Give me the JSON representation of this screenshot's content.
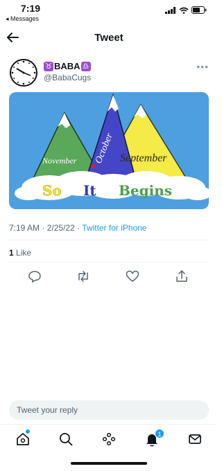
{
  "status_bar": {
    "time": "7:19",
    "back_label": "◂ Messages"
  },
  "nav": {
    "title": "Tweet"
  },
  "author": {
    "name": "BABA",
    "zodiac_left": "♉",
    "zodiac_right": "♎",
    "handle": "@BabaCugs",
    "more": "•••"
  },
  "tweet": {
    "image": {
      "labels": {
        "left": "November",
        "middle": "October",
        "right": "September"
      },
      "banner": [
        "So",
        "It",
        "Begins"
      ]
    },
    "time": "7:19 AM",
    "date": "2/25/22",
    "source": "Twitter for iPhone",
    "separator": "·"
  },
  "engagement": {
    "count": "1",
    "label": "Like"
  },
  "reply": {
    "placeholder": "Tweet your reply"
  },
  "tabs": [
    {
      "name": "home-icon"
    },
    {
      "name": "search-icon"
    },
    {
      "name": "spaces-icon"
    },
    {
      "name": "notifications-icon",
      "badge": "1"
    },
    {
      "name": "messages-icon"
    }
  ],
  "colors": {
    "accent": "#1d9bf0",
    "sky": "#4e9fe0",
    "green_peak": "#5aa85a",
    "blue_peak": "#4545c8",
    "yellow_peak": "#f4ea48"
  }
}
